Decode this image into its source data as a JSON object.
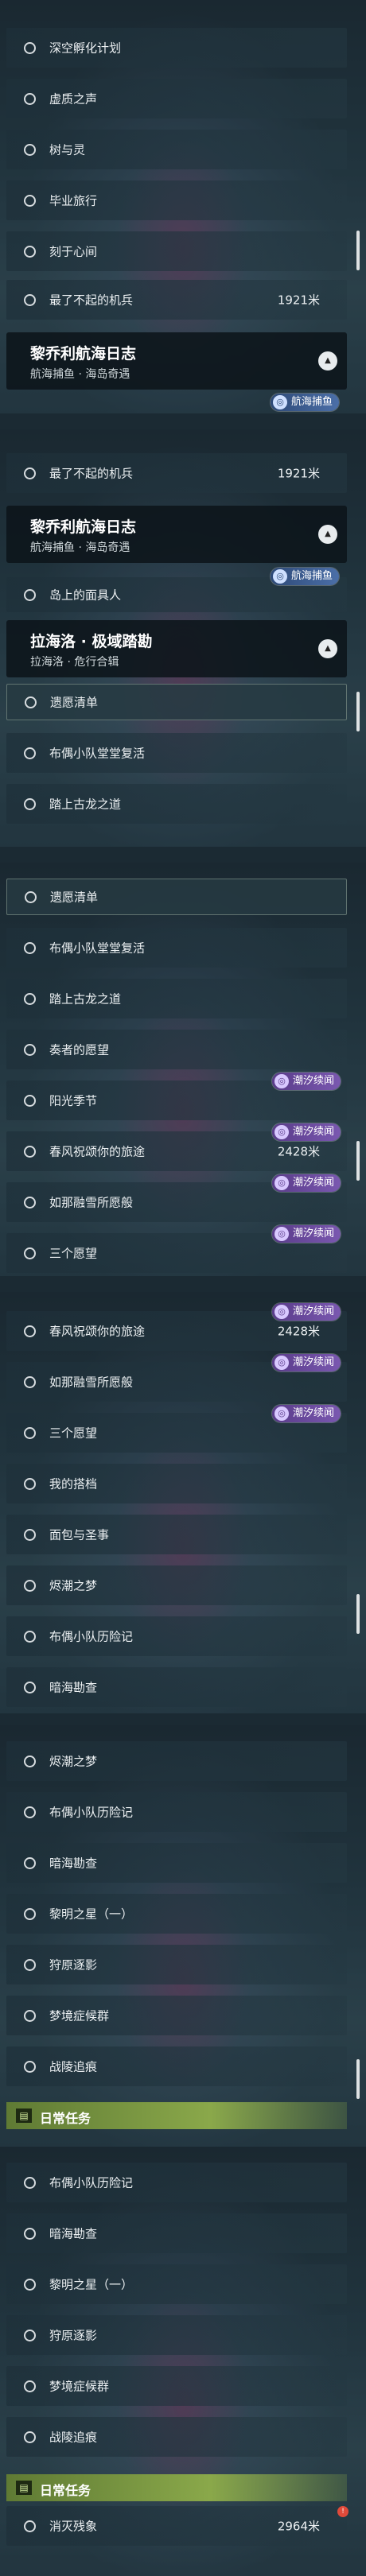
{
  "colors": {
    "accent_purple": "#7a58b0",
    "accent_green": "#8aa84a",
    "header_bg": "#0c141a"
  },
  "icons": {
    "bullet": "circle-outline-icon",
    "badge": "tide-icon",
    "caret": "chevron-up-icon",
    "daily": "task-book-icon"
  },
  "panel1": {
    "items": [
      {
        "label": "深空孵化计划"
      },
      {
        "label": "虚质之声"
      },
      {
        "label": "树与灵"
      },
      {
        "label": "毕业旅行"
      },
      {
        "label": "刻于心间"
      },
      {
        "label": "最了不起的机兵",
        "distance": "1921米"
      }
    ],
    "header": {
      "title": "黎乔利航海日志",
      "subtitle": "航海捕鱼 · 海岛奇遇"
    },
    "badge": "航海捕鱼"
  },
  "panel2": {
    "item_top": {
      "label": "最了不起的机兵",
      "distance": "1921米"
    },
    "header1": {
      "title": "黎乔利航海日志",
      "subtitle": "航海捕鱼 · 海岛奇遇"
    },
    "badge": "航海捕鱼",
    "item_mid": {
      "label": "岛上的面具人"
    },
    "header2": {
      "title": "拉海洛 · 极域踏勘",
      "subtitle": "拉海洛 · 危行合辑"
    },
    "items": [
      {
        "label": "遗愿清单"
      },
      {
        "label": "布偶小队堂堂复活"
      },
      {
        "label": "踏上古龙之道"
      }
    ]
  },
  "panel3": {
    "items": [
      {
        "label": "遗愿清单"
      },
      {
        "label": "布偶小队堂堂复活"
      },
      {
        "label": "踏上古龙之道"
      },
      {
        "label": "奏者的愿望"
      },
      {
        "label": "阳光季节"
      },
      {
        "label": "春风祝颂你的旅途",
        "distance": "2428米"
      },
      {
        "label": "如那融雪所愿般"
      },
      {
        "label": "三个愿望"
      }
    ],
    "badge": "潮汐续闻"
  },
  "panel4": {
    "items": [
      {
        "label": "春风祝颂你的旅途",
        "distance": "2428米"
      },
      {
        "label": "如那融雪所愿般"
      },
      {
        "label": "三个愿望"
      },
      {
        "label": "我的搭档"
      },
      {
        "label": "面包与圣事"
      },
      {
        "label": "烬潮之梦"
      },
      {
        "label": "布偶小队历险记"
      },
      {
        "label": "暗海勘查"
      }
    ],
    "badge": "潮汐续闻"
  },
  "panel5": {
    "items": [
      {
        "label": "烬潮之梦"
      },
      {
        "label": "布偶小队历险记"
      },
      {
        "label": "暗海勘查"
      },
      {
        "label": "黎明之星（一）"
      },
      {
        "label": "狩原逐影"
      },
      {
        "label": "梦境症候群"
      },
      {
        "label": "战陵追痕"
      }
    ],
    "daily_label": "日常任务"
  },
  "panel6": {
    "items": [
      {
        "label": "布偶小队历险记"
      },
      {
        "label": "暗海勘查"
      },
      {
        "label": "黎明之星（一）"
      },
      {
        "label": "狩原逐影"
      },
      {
        "label": "梦境症候群"
      },
      {
        "label": "战陵追痕"
      }
    ],
    "daily_label": "日常任务",
    "last_item": {
      "label": "消灭残象",
      "distance": "2964米"
    }
  }
}
